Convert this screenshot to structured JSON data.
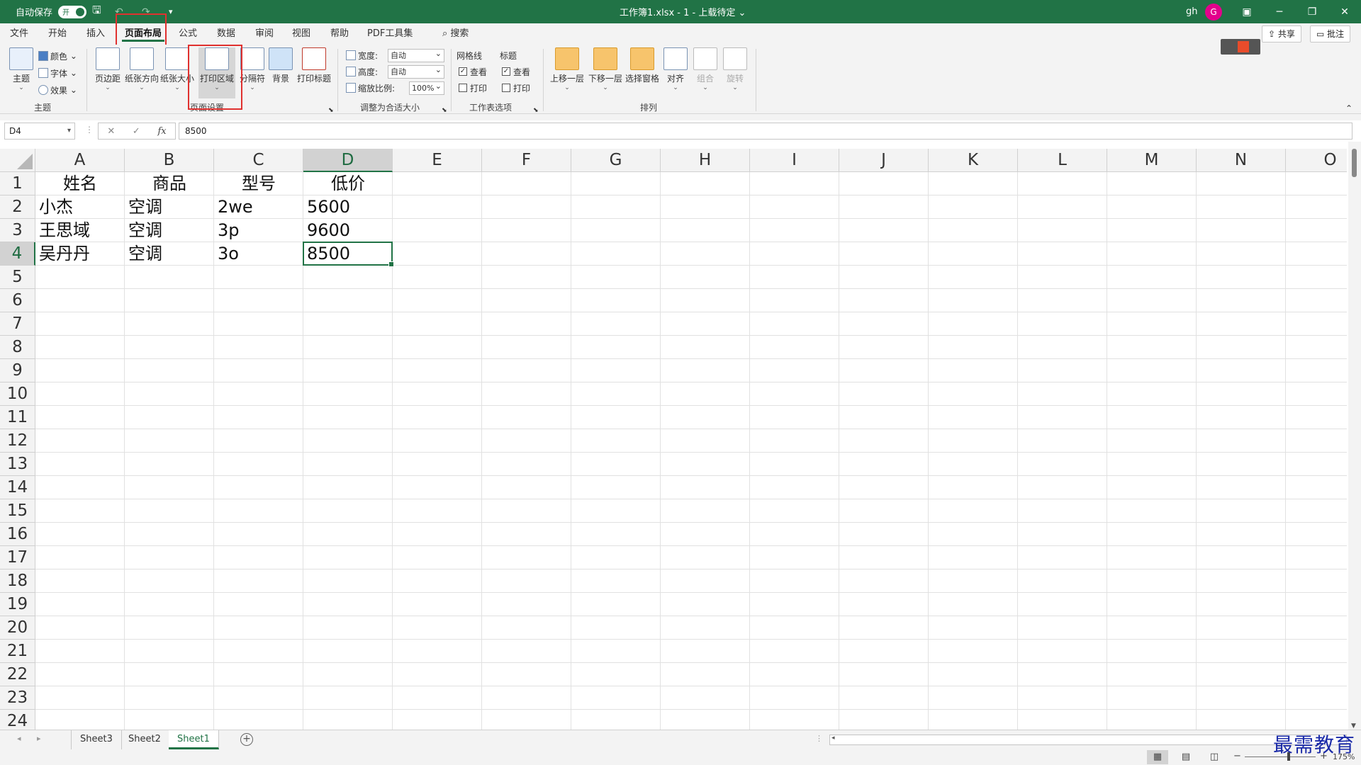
{
  "titlebar": {
    "autosave_label": "自动保存",
    "autosave_state": "开",
    "doc_title": "工作簿1.xlsx - 1 - 上载待定 ⌄",
    "user": "gh",
    "avatar_letter": "G"
  },
  "tabs": [
    "文件",
    "开始",
    "插入",
    "页面布局",
    "公式",
    "数据",
    "审阅",
    "视图",
    "帮助",
    "PDF工具集"
  ],
  "active_tab": "页面布局",
  "search_label": "搜索",
  "share_label": "共享",
  "comment_label": "批注",
  "ribbon": {
    "theme": {
      "main": "主题",
      "colors": "颜色",
      "fonts": "字体",
      "effects": "效果",
      "group": "主题"
    },
    "page_setup": {
      "margins": "页边距",
      "orientation": "纸张方向",
      "size": "纸张大小",
      "print_area": "打印区域",
      "breaks": "分隔符",
      "background": "背景",
      "print_titles": "打印标题",
      "group": "页面设置"
    },
    "scale": {
      "width_label": "宽度:",
      "width_value": "自动",
      "height_label": "高度:",
      "height_value": "自动",
      "scale_label": "缩放比例:",
      "scale_value": "100%",
      "group": "调整为合适大小"
    },
    "sheet_options": {
      "gridlines": "网格线",
      "headings": "标题",
      "view": "查看",
      "print": "打印",
      "group": "工作表选项"
    },
    "arrange": {
      "bring_forward": "上移一层",
      "send_backward": "下移一层",
      "selection_pane": "选择窗格",
      "align": "对齐",
      "group_btn": "组合",
      "rotate": "旋转",
      "group": "排列"
    }
  },
  "formula_bar": {
    "name_box": "D4",
    "cancel": "✕",
    "enter": "✓",
    "fx": "fx",
    "value": "8500"
  },
  "grid": {
    "columns": [
      "A",
      "B",
      "C",
      "D",
      "E",
      "F",
      "G",
      "H",
      "I",
      "J",
      "K",
      "L",
      "M",
      "N",
      "O"
    ],
    "rows": [
      "1",
      "2",
      "3",
      "4",
      "5",
      "6",
      "7",
      "8",
      "9",
      "10",
      "11",
      "12",
      "13",
      "14",
      "15",
      "16",
      "17",
      "18",
      "19",
      "20",
      "21",
      "22",
      "23",
      "24"
    ],
    "selected_col": "D",
    "selected_row": "4",
    "cells": [
      [
        "姓名",
        "商品",
        "型号",
        "低价"
      ],
      [
        "小杰",
        "空调",
        "2we",
        "5600"
      ],
      [
        "王思域",
        "空调",
        "3p",
        "9600"
      ],
      [
        "吴丹丹",
        "空调",
        "3o",
        "8500"
      ]
    ]
  },
  "sheets": [
    "Sheet3",
    "Sheet2",
    "Sheet1"
  ],
  "active_sheet": "Sheet1",
  "status": {
    "zoom": "175%"
  },
  "watermark": "最需教育"
}
